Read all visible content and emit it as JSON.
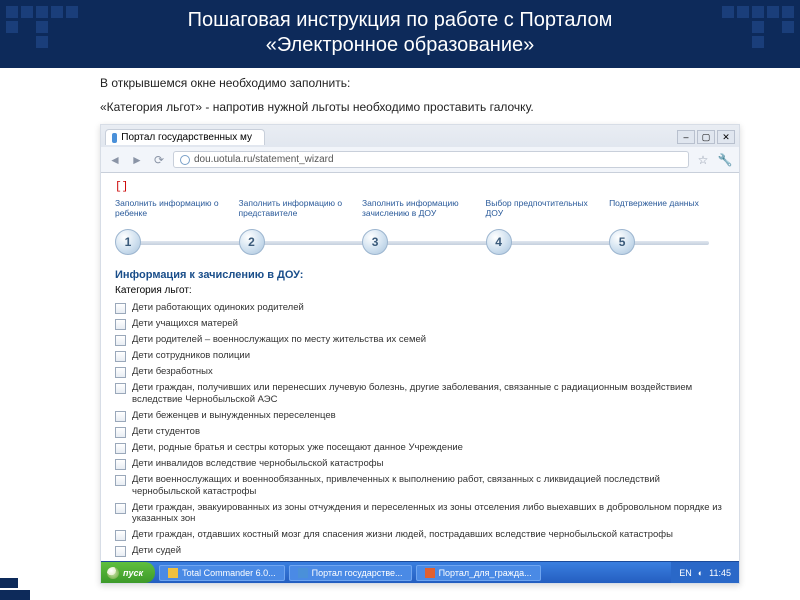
{
  "title_line1": "Пошаговая инструкция по работе с Порталом",
  "title_line2": "«Электронное образование»",
  "intro1": "В открывшемся окне необходимо заполнить:",
  "intro2": "«Категория льгот» - напротив нужной льготы необходимо проставить галочку.",
  "browser": {
    "tab_title": "Портал государственных му",
    "url": "dou.uotula.ru/statement_wizard",
    "red_marks": "[]"
  },
  "wizard_steps": [
    {
      "num": "1",
      "label": "Заполнить информацию о ребенке"
    },
    {
      "num": "2",
      "label": "Заполнить информацию о представителе"
    },
    {
      "num": "3",
      "label": "Заполнить информацию зачислению в ДОУ"
    },
    {
      "num": "4",
      "label": "Выбор предпочтительных ДОУ"
    },
    {
      "num": "5",
      "label": "Подтвержение данных"
    }
  ],
  "section_title": "Информация к зачислению в ДОУ:",
  "field_label": "Категория льгот:",
  "benefits": [
    "Дети работающих одиноких родителей",
    "Дети учащихся матерей",
    "Дети родителей – военнослужащих по месту жительства их семей",
    "Дети сотрудников полиции",
    "Дети безработных",
    "Дети граждан, получивших или перенесших лучевую болезнь, другие заболевания, связанные с радиационным воздействием вследствие Чернобыльской АЭС",
    "Дети беженцев и вынужденных переселенцев",
    "Дети студентов",
    "Дети, родные братья и сестры которых уже посещают данное Учреждение",
    "Дети инвалидов вследствие чернобыльской катастрофы",
    "Дети военнослужащих и военнообязанных, привлеченных к выполнению работ, связанных с ликвидацией последствий чернобыльской катастрофы",
    "Дети граждан, эвакуированных из зоны отчуждения и переселенных из зоны отселения либо выехавших в добровольном порядке из указанных зон",
    "Дети граждан, отдавших костный мозг для спасения жизни людей, пострадавших вследствие чернобыльской катастрофы",
    "Дети судей"
  ],
  "taskbar": {
    "start": "пуск",
    "tasks": [
      "Total Commander 6.0...",
      "Портал государстве...",
      "Портал_для_гражда..."
    ],
    "lang": "EN",
    "time": "11:45"
  }
}
